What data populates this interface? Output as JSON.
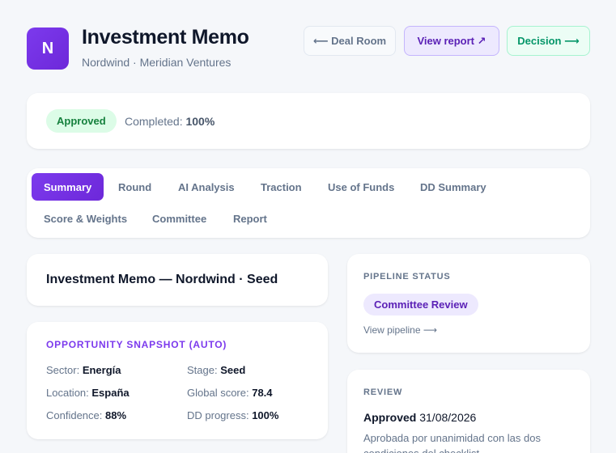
{
  "header": {
    "logo_letter": "N",
    "title": "Investment Memo",
    "subtitle": "Nordwind · Meridian Ventures",
    "deal_room_label": "⟵ Deal Room",
    "view_report_label": "View report ↗",
    "decision_label": "Decision ⟶"
  },
  "status": {
    "badge": "Approved",
    "completed_label": "Completed:",
    "completed_value": "100%"
  },
  "tabs": [
    {
      "label": "Summary",
      "active": true
    },
    {
      "label": "Round"
    },
    {
      "label": "AI Analysis"
    },
    {
      "label": "Traction"
    },
    {
      "label": "Use of Funds"
    },
    {
      "label": "DD Summary"
    },
    {
      "label": "Score & Weights"
    },
    {
      "label": "Committee"
    },
    {
      "label": "Report"
    }
  ],
  "memo": {
    "title": "Investment Memo — Nordwind · Seed"
  },
  "snapshot": {
    "heading": "OPPORTUNITY SNAPSHOT (AUTO)",
    "sector_label": "Sector:",
    "sector_value": "Energía",
    "stage_label": "Stage:",
    "stage_value": "Seed",
    "location_label": "Location:",
    "location_value": "España",
    "score_label": "Global score:",
    "score_value": "78.4",
    "confidence_label": "Confidence:",
    "confidence_value": "88%",
    "dd_label": "DD progress:",
    "dd_value": "100%"
  },
  "pipeline": {
    "heading": "PIPELINE STATUS",
    "stage": "Committee Review",
    "link": "View pipeline ⟶"
  },
  "review": {
    "heading": "REVIEW",
    "status": "Approved",
    "date": "31/08/2026",
    "note": "Aprobada por unanimidad con las dos condiciones del checklist."
  },
  "colors": {
    "accent": "#7c3aed",
    "approved_bg": "#dcfce7",
    "approved_text": "#15803d"
  }
}
